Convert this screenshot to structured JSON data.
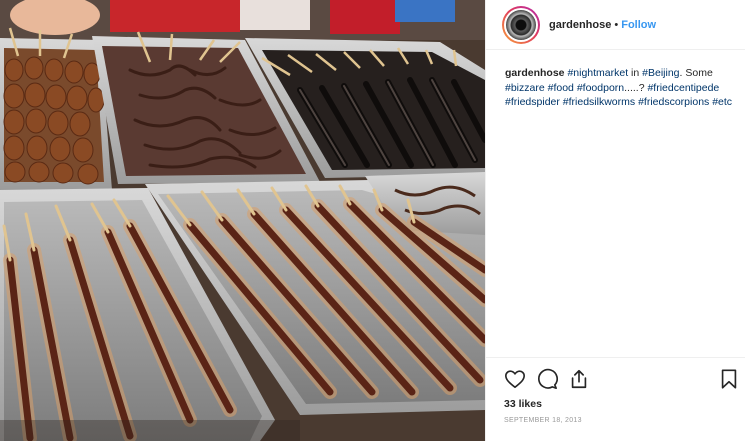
{
  "post": {
    "username": "gardenhose",
    "separator": "•",
    "follow_label": "Follow",
    "caption_user": "gardenhose",
    "caption_parts": [
      {
        "text": "#nightmarket",
        "tag": true
      },
      {
        "text": " in ",
        "tag": false
      },
      {
        "text": "#Beijing",
        "tag": true
      },
      {
        "text": ". Some ",
        "tag": false
      },
      {
        "text": "#bizzare",
        "tag": true
      },
      {
        "text": " ",
        "tag": false
      },
      {
        "text": "#food",
        "tag": true
      },
      {
        "text": " ",
        "tag": false
      },
      {
        "text": "#foodporn",
        "tag": true
      },
      {
        "text": ".....? ",
        "tag": false
      },
      {
        "text": "#friedcentipede",
        "tag": true
      },
      {
        "text": " ",
        "tag": false
      },
      {
        "text": "#friedspider",
        "tag": true
      },
      {
        "text": " ",
        "tag": false
      },
      {
        "text": "#friedsilkworms",
        "tag": true
      },
      {
        "text": " ",
        "tag": false
      },
      {
        "text": "#friedscorpions",
        "tag": true
      },
      {
        "text": " ",
        "tag": false
      },
      {
        "text": "#etc",
        "tag": true
      }
    ],
    "likes": "33 likes",
    "date": "SEPTEMBER 18, 2013"
  },
  "icons": {
    "like": "heart-icon",
    "comment": "comment-icon",
    "share": "share-icon",
    "save": "bookmark-icon"
  },
  "colors": {
    "link": "#3897f0",
    "hashtag": "#003569",
    "text": "#262626",
    "muted": "#999999",
    "border": "#efefef"
  }
}
